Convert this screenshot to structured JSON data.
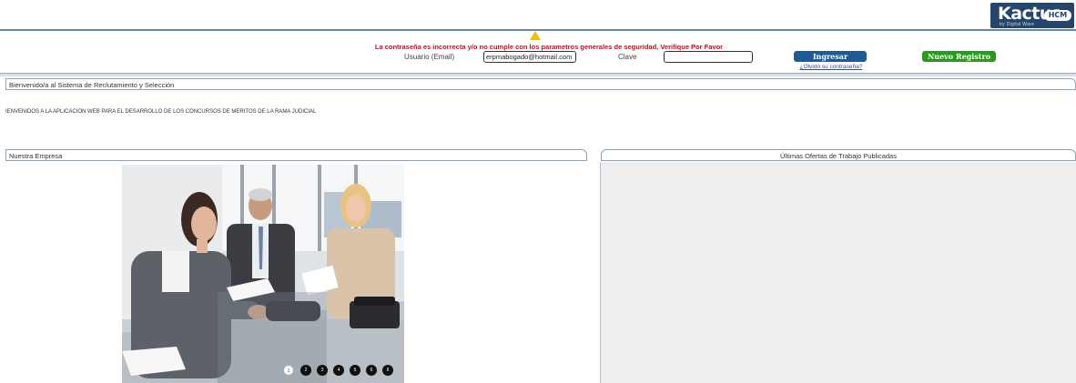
{
  "header": {
    "logo_text": "Kactus",
    "logo_suffix": "HCM",
    "logo_sub": "by Digital Ware",
    "error_message": "La contraseña es incorrecta y/o no cumple con los parametros generales de seguridad, Verifique Por Favor",
    "user_label": "Usuario (Email)",
    "user_value": "erpmabogado@hotmail.com",
    "password_label": "Clave",
    "password_value": "",
    "login_button": "Ingresar",
    "register_button": "Nuevo Registro",
    "forgot_link": "¿Olvidó su contraseña?"
  },
  "welcome": {
    "title": "Bienvenido/a al Sistema de Reclutamiento y Selección",
    "text": "IENVENIDOS A LA APLICACION WEB PARA EL DESARROLLO DE LOS CONCURSOS DE MERITOS DE LA RAMA JUDICIAL"
  },
  "company": {
    "title": "Nuestra Empresa"
  },
  "offers": {
    "title": "Últimas Ofertas de Trabajo Publicadas"
  },
  "slideshow": {
    "dots": [
      "1",
      "2",
      "3",
      "4",
      "5",
      "6"
    ],
    "pause": "II"
  },
  "colors": {
    "error": "#c0101a",
    "login_button": "#1e5a96",
    "register_button": "#2a9a1e",
    "logo_bg": "#24466d"
  }
}
